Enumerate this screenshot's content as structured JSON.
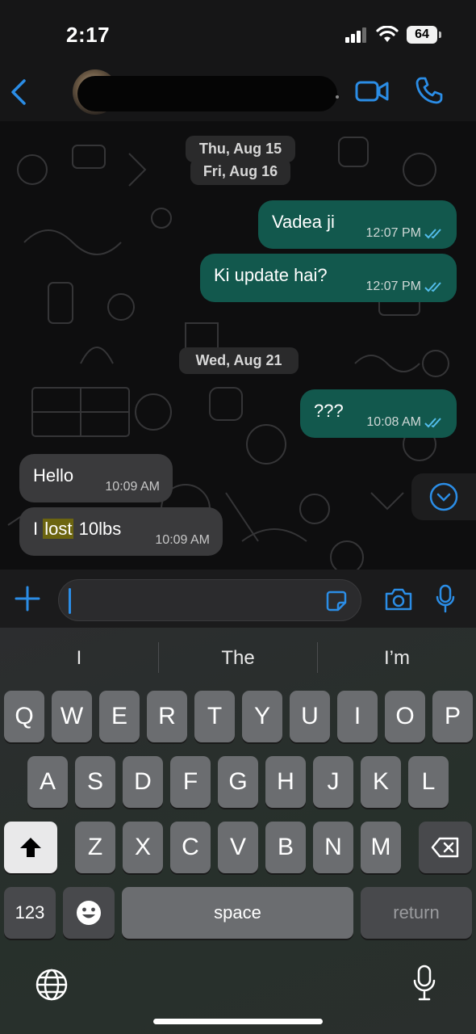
{
  "status_bar": {
    "time": "2:17",
    "battery": "64"
  },
  "header": {
    "back_icon": "chevron-left-icon",
    "video_icon": "video-call-icon",
    "call_icon": "phone-icon"
  },
  "chat": {
    "dates": [
      "Thu, Aug 15",
      "Fri, Aug 16",
      "Wed, Aug 21"
    ],
    "messages": [
      {
        "dir": "out",
        "text": "Vadea ji",
        "time": "12:07 PM"
      },
      {
        "dir": "out",
        "text": "Ki update hai?",
        "time": "12:07 PM"
      },
      {
        "dir": "out",
        "text": "???",
        "time": "10:08 AM"
      },
      {
        "dir": "in",
        "text": "Hello",
        "time": "10:09 AM"
      },
      {
        "dir": "in",
        "text_before": "I ",
        "text_highlight": "lost",
        "text_after": " 10lbs",
        "time": "10:09 AM"
      }
    ]
  },
  "input": {
    "placeholder": "",
    "value": ""
  },
  "keyboard": {
    "suggestions": [
      "I",
      "The",
      "I’m"
    ],
    "row1": [
      "Q",
      "W",
      "E",
      "R",
      "T",
      "Y",
      "U",
      "I",
      "O",
      "P"
    ],
    "row2": [
      "A",
      "S",
      "D",
      "F",
      "G",
      "H",
      "J",
      "K",
      "L"
    ],
    "row3": [
      "Z",
      "X",
      "C",
      "V",
      "B",
      "N",
      "M"
    ],
    "numbers_key": "123",
    "space_key": "space",
    "return_key": "return"
  },
  "colors": {
    "accent": "#2b8de6",
    "outgoing_bubble": "#12584d",
    "incoming_bubble": "#3a3a3c"
  }
}
